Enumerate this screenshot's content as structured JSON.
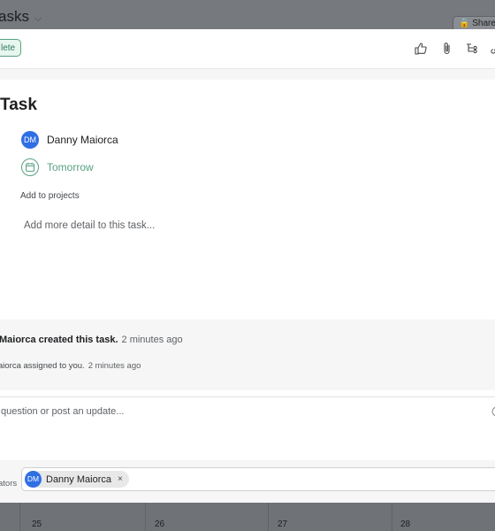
{
  "background": {
    "title": "asks",
    "share_label": "Share",
    "calendar_days": [
      "25",
      "26",
      "27",
      "28"
    ]
  },
  "toolbar": {
    "complete_label": "lete",
    "icons": [
      "thumbs-up-icon",
      "paperclip-icon",
      "subtask-icon",
      "link-icon"
    ]
  },
  "task": {
    "title": "Task",
    "assignee": {
      "initials": "DM",
      "name": "Danny Maiorca"
    },
    "due_date": "Tomorrow",
    "projects_label": "Add to projects",
    "description_placeholder": "Add more detail to this task...",
    "dependencies_fragment": ":"
  },
  "activity": [
    {
      "text": "Maiorca created this task.",
      "time": "2 minutes ago"
    },
    {
      "text": "aiorca assigned to you.",
      "time": "2 minutes ago"
    }
  ],
  "comment": {
    "placeholder": "question or post an update..."
  },
  "collaborators": {
    "label": "ators",
    "chip": {
      "initials": "DM",
      "name": "Danny Maiorca",
      "remove": "×"
    }
  },
  "colors": {
    "accent_green": "#58a182",
    "avatar_blue": "#2f6fe4"
  }
}
